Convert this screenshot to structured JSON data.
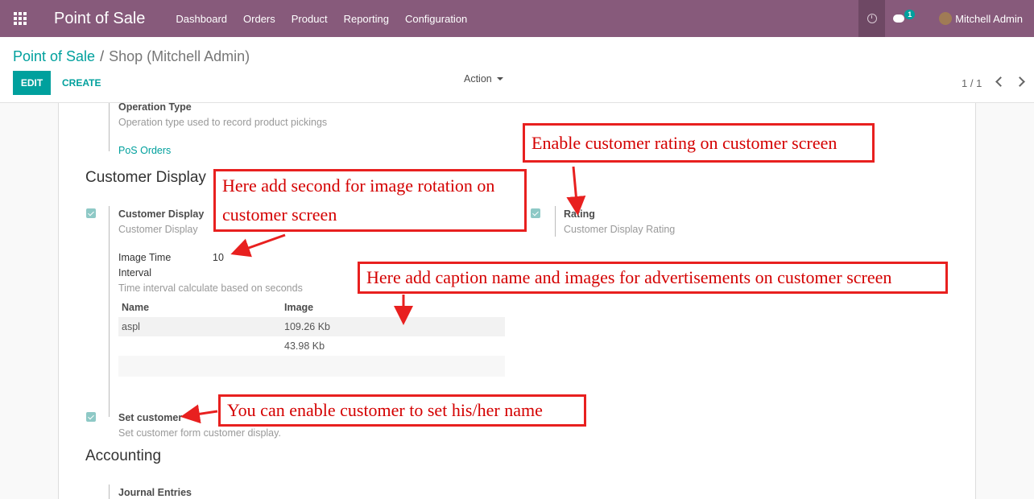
{
  "navbar": {
    "brand": "Point of Sale",
    "menu": [
      "Dashboard",
      "Orders",
      "Product",
      "Reporting",
      "Configuration"
    ],
    "chat_badge": "1",
    "user_name": "Mitchell Admin"
  },
  "control": {
    "breadcrumb_root": "Point of Sale",
    "breadcrumb_sep": "/",
    "breadcrumb_current": "Shop (Mitchell Admin)",
    "edit_label": "EDIT",
    "create_label": "CREATE",
    "action_label": "Action",
    "pager": "1 / 1"
  },
  "form": {
    "operation_type_label": "Operation Type",
    "operation_type_help": "Operation type used to record product pickings",
    "pos_orders_link": "PoS Orders",
    "customer_display_section": "Customer Display",
    "customer_display_label": "Customer Display",
    "customer_display_help": "Customer Display",
    "rating_label": "Rating",
    "rating_help": "Customer Display Rating",
    "image_time_label_1": "Image Time",
    "image_time_label_2": "Interval",
    "image_time_value": "10",
    "image_time_help": "Time interval calculate based on seconds",
    "table": {
      "headers": [
        "Name",
        "Image"
      ],
      "rows": [
        [
          "aspl",
          "109.26 Kb"
        ],
        [
          "",
          "43.98 Kb"
        ]
      ]
    },
    "set_customer_label": "Set customer",
    "set_customer_help": "Set customer form customer display.",
    "accounting_section": "Accounting",
    "journal_entries_label": "Journal Entries"
  },
  "annotations": {
    "rating_note": "Enable customer rating on customer screen",
    "rotation_note_line1": "Here add second for image rotation on",
    "rotation_note_line2": "customer screen",
    "caption_note": "Here add caption name and images for advertisements on customer screen",
    "set_customer_note": "You can enable customer to set his/her name",
    "color": "#e8201f"
  }
}
